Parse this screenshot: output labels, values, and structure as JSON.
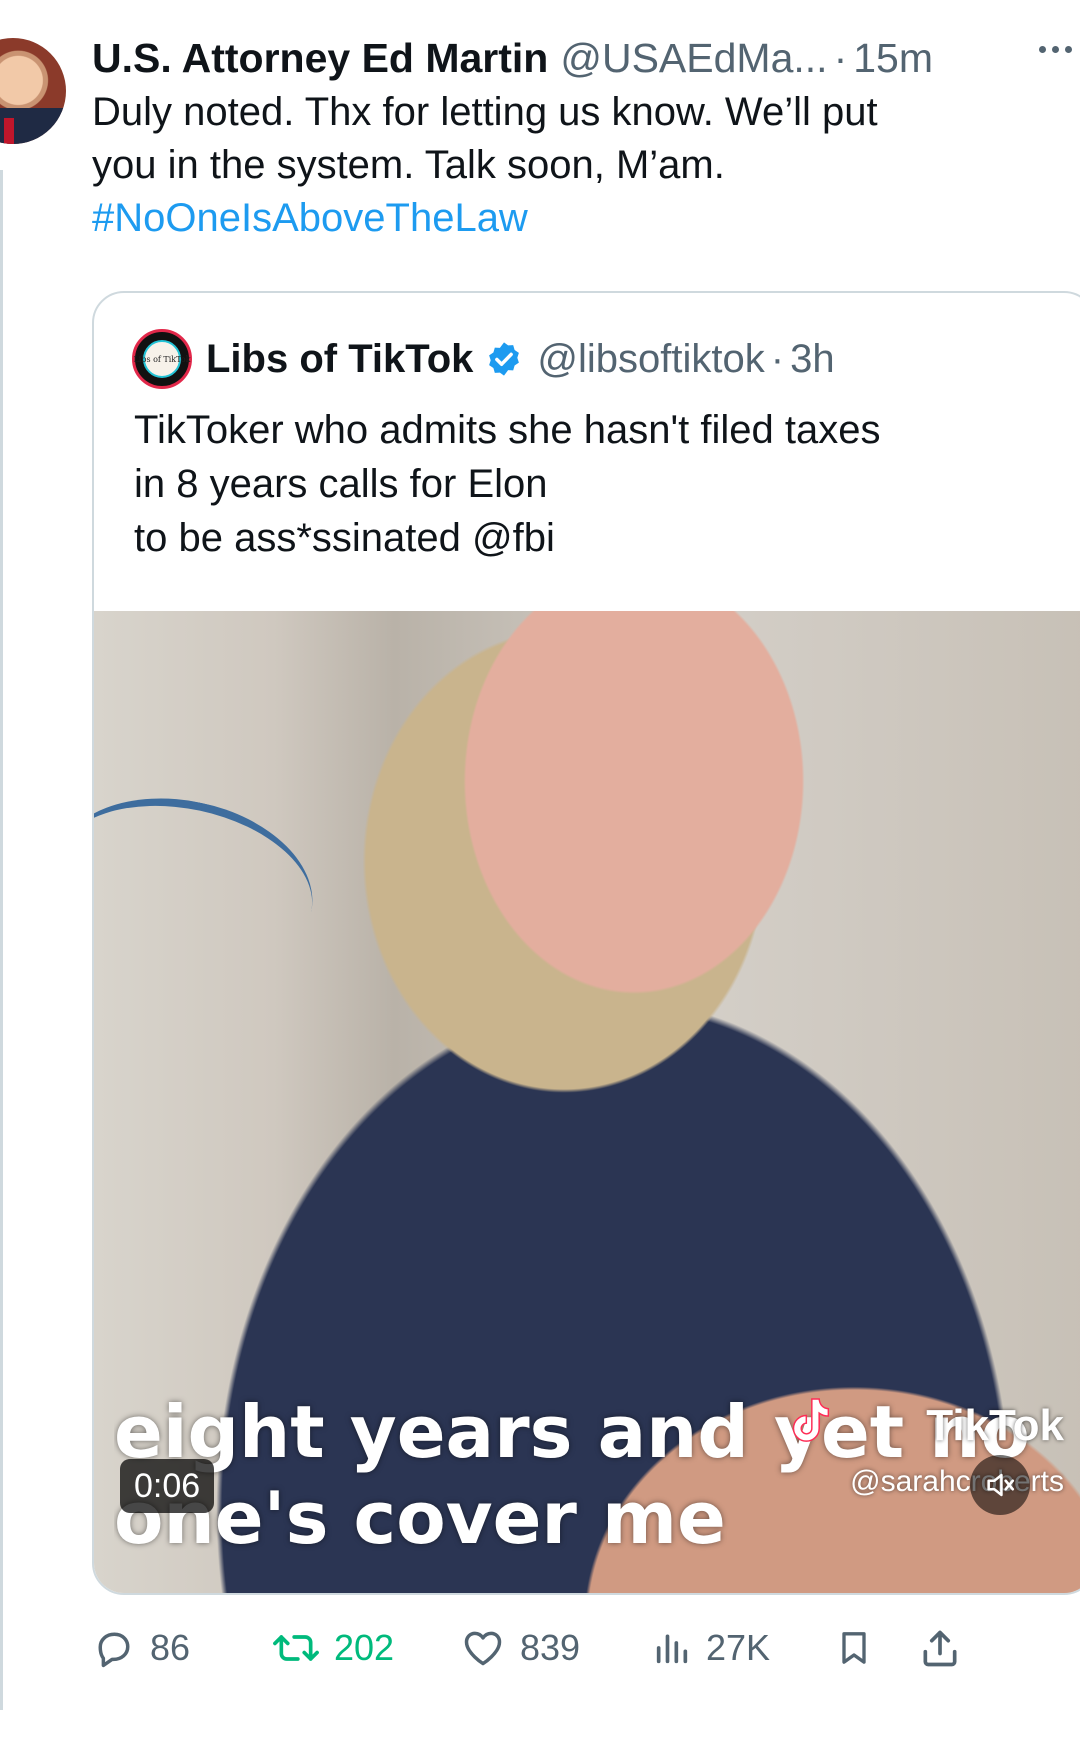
{
  "tweet": {
    "author_name": "U.S. Attorney Ed Martin",
    "author_handle": "@USAEdMa...",
    "separator": "·",
    "time": "15m",
    "text_line1": "Duly noted. Thx for letting us know. We’ll put",
    "text_line2": "you in the system. Talk soon, M’am.",
    "hashtag": "#NoOneIsAboveTheLaw"
  },
  "quote": {
    "avatar_text": "Libs of TikTok",
    "author_name": "Libs of TikTok",
    "author_handle": "@libsoftiktok",
    "separator": "·",
    "time": "3h",
    "text_line1": "TikToker who admits she hasn't filed taxes",
    "text_line2": "in 8 years calls for Elon",
    "text_line3": "to be ass*ssinated @fbi",
    "video": {
      "caption_line1": "eight years and yet no",
      "caption_line2": "one's cover me",
      "watermark_brand": "TikTok",
      "watermark_handle": "@sarahcroberts",
      "duration": "0:06"
    }
  },
  "actions": {
    "replies": "86",
    "retweets": "202",
    "likes": "839",
    "views": "27K"
  },
  "colors": {
    "link": "#1d9bf0",
    "muted": "#536471",
    "retweet": "#00ba7c",
    "border": "#cfd9de"
  }
}
